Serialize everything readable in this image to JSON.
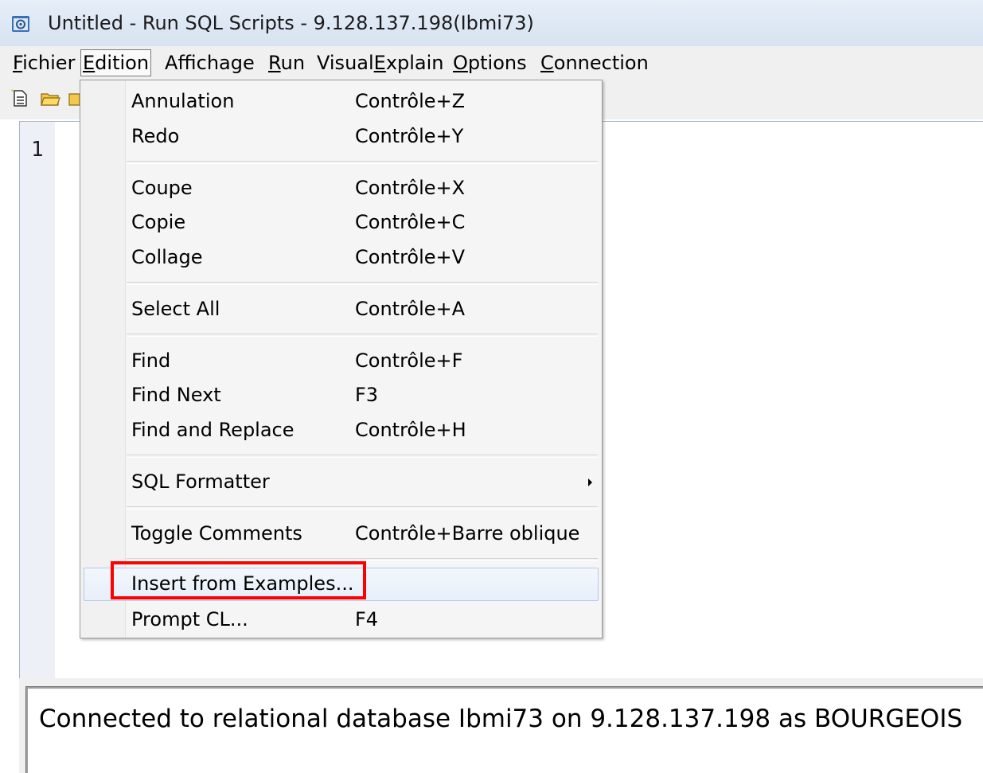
{
  "window": {
    "title": "Untitled - Run SQL Scripts - 9.128.137.198(Ibmi73)"
  },
  "menubar": {
    "items": [
      {
        "label": "Fichier",
        "mnemonic": "F"
      },
      {
        "label": "Edition",
        "mnemonic": "E"
      },
      {
        "label": "Affichage",
        "mnemonic": "i"
      },
      {
        "label": "Run",
        "mnemonic": "R"
      },
      {
        "label": "VisualExplain",
        "mnemonic": "x"
      },
      {
        "label": "Options",
        "mnemonic": "O"
      },
      {
        "label": "Connection",
        "mnemonic": "C"
      }
    ],
    "active": "Edition"
  },
  "toolbar": {
    "icons": [
      "new-script-icon",
      "open-folder-icon",
      "save-icon"
    ]
  },
  "editor": {
    "line_number": "1",
    "content": ""
  },
  "edit_menu": {
    "items": [
      {
        "label": "Annulation",
        "shortcut": "Contrôle+Z"
      },
      {
        "label": "Redo",
        "shortcut": "Contrôle+Y"
      },
      {
        "label": "Coupe",
        "shortcut": "Contrôle+X"
      },
      {
        "label": "Copie",
        "shortcut": "Contrôle+C"
      },
      {
        "label": "Collage",
        "shortcut": "Contrôle+V"
      },
      {
        "label": "Select All",
        "shortcut": "Contrôle+A"
      },
      {
        "label": "Find",
        "shortcut": "Contrôle+F"
      },
      {
        "label": "Find Next",
        "shortcut": "F3"
      },
      {
        "label": "Find and Replace",
        "shortcut": "Contrôle+H"
      },
      {
        "label": "SQL Formatter",
        "shortcut": "",
        "submenu": true
      },
      {
        "label": "Toggle Comments",
        "shortcut": "Contrôle+Barre oblique"
      },
      {
        "label": "Insert from Examples...",
        "shortcut": "",
        "highlighted": true
      },
      {
        "label": "Prompt CL...",
        "shortcut": "F4"
      }
    ],
    "highlight_color": "#ff0000"
  },
  "status": {
    "message": "Connected to relational database Ibmi73 on 9.128.137.198 as BOURGEOIS"
  }
}
